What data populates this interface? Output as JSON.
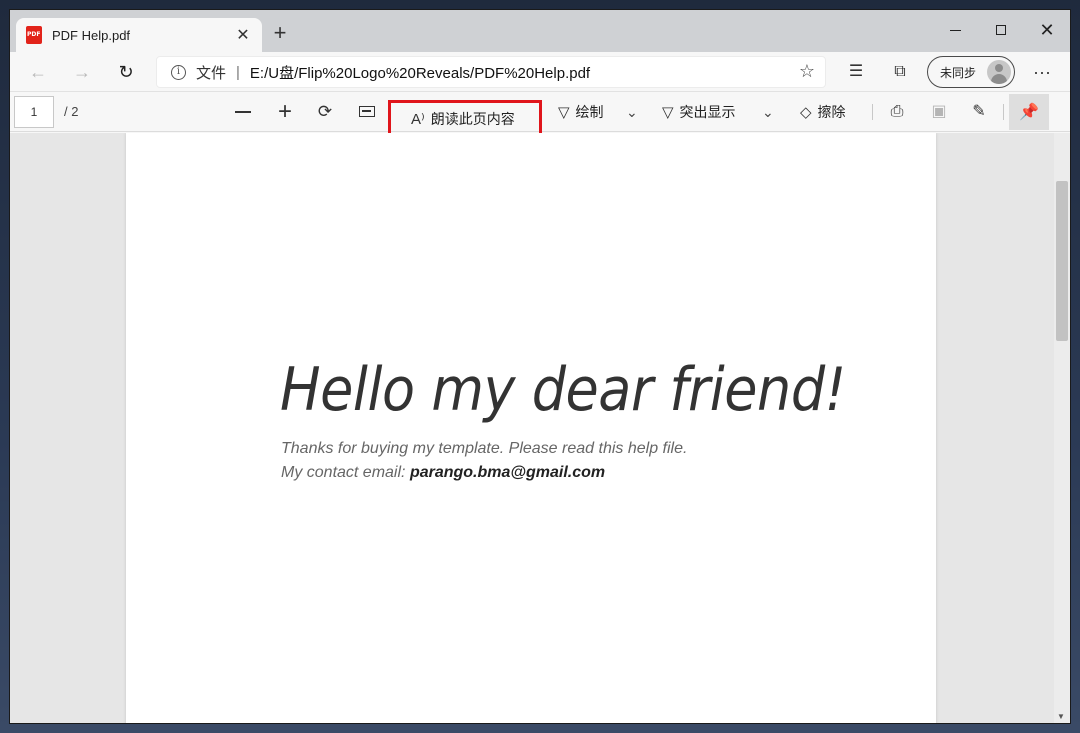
{
  "tab": {
    "title": "PDF Help.pdf",
    "close": "✕",
    "new_tab": "+"
  },
  "window_controls": {
    "close": "✕"
  },
  "nav": {
    "back": "←",
    "forward": "→",
    "refresh": "↻"
  },
  "address": {
    "info": "i",
    "label": "文件",
    "separator": "|",
    "url": "E:/U盘/Flip%20Logo%20Reveals/PDF%20Help.pdf",
    "favorite": "☆"
  },
  "toolbar": {
    "favorites_icon": "☰",
    "collections_icon": "⧉",
    "profile_label": "未同步",
    "more": "···"
  },
  "pdf_toolbar": {
    "page_number": "1",
    "page_total": "/ 2",
    "zoom_in": "+",
    "rotate": "⟳",
    "read_aloud_icon": "A⁾",
    "read_aloud": "朗读此页内容",
    "draw_icon": "▽",
    "draw": "绘制",
    "draw_chevron": "⌄",
    "highlight_icon": "▽",
    "highlight": "突出显示",
    "highlight_chevron": "⌄",
    "erase_icon": "◇",
    "erase": "擦除",
    "print": "⎙",
    "save": "▣",
    "save_as": "✎",
    "pin": "📌"
  },
  "document": {
    "heading": "Hello my dear friend!",
    "line1": "Thanks for buying my template. Please read this help file.",
    "line2_prefix": "My contact email: ",
    "email": "parango.bma@gmail.com"
  },
  "colors": {
    "highlight_box": "#e0151b",
    "pdf_icon": "#e2231a"
  }
}
